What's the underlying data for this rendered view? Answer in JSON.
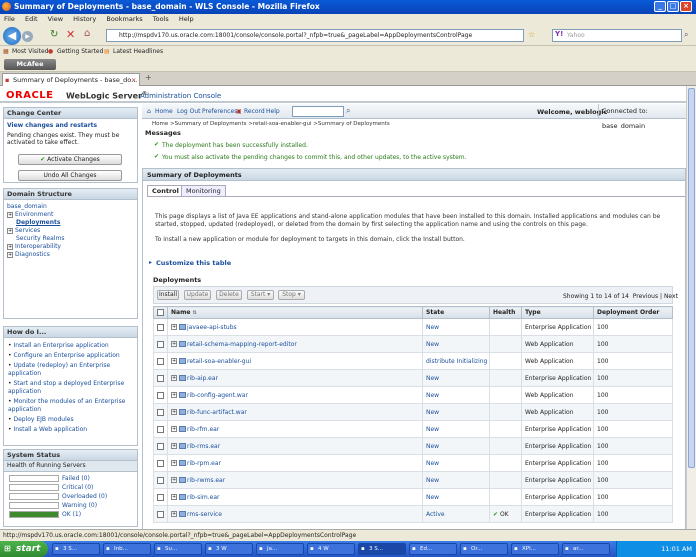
{
  "window": {
    "title": "Summary of Deployments - base_domain - WLS Console - Mozilla Firefox"
  },
  "menu": [
    "File",
    "Edit",
    "View",
    "History",
    "Bookmarks",
    "Tools",
    "Help"
  ],
  "nav": {
    "url": "http://mspdv170.us.oracle.com:18001/console/console.portal?_nfpb=true&_pageLabel=AppDeploymentsControlPage",
    "search_placeholder": "Yahoo"
  },
  "bookmarks": [
    "Most Visited",
    "Getting Started",
    "Latest Headlines"
  ],
  "mcafee": "McAfee",
  "tab": {
    "label": "Summary of Deployments - base_do...",
    "new": "+"
  },
  "brand": {
    "oracle": "ORACLE",
    "product": "WebLogic Server",
    "reg": "®",
    "subtitle": "Administration Console"
  },
  "change_center": {
    "title": "Change Center",
    "link": "View changes and restarts",
    "text": "Pending changes exist. They must be activated to take effect.",
    "activate": "Activate Changes",
    "undo": "Undo All Changes"
  },
  "domain_structure": {
    "title": "Domain Structure",
    "items": [
      "base_domain",
      "Environment",
      "Deployments",
      "Services",
      "Security Realms",
      "Interoperability",
      "Diagnostics"
    ]
  },
  "howdo": {
    "title": "How do I...",
    "items": [
      "Install an Enterprise application",
      "Configure an Enterprise application",
      "Update (redeploy) an Enterprise application",
      "Start and stop a deployed Enterprise application",
      "Monitor the modules of an Enterprise application",
      "Deploy EJB modules",
      "Install a Web application"
    ]
  },
  "system_status": {
    "title": "System Status",
    "subtitle": "Health of Running Servers",
    "rows": [
      {
        "label": "Failed (0)",
        "color": "#ffffff",
        "fill": 0
      },
      {
        "label": "Critical (0)",
        "color": "#ffffff",
        "fill": 0
      },
      {
        "label": "Overloaded (0)",
        "color": "#ffffff",
        "fill": 0
      },
      {
        "label": "Warning (0)",
        "color": "#ffffff",
        "fill": 0
      },
      {
        "label": "OK (1)",
        "color": "#3f8a2e",
        "fill": 1
      }
    ]
  },
  "topnav": {
    "home": "Home",
    "logout": "Log Out",
    "preferences": "Preferences",
    "record": "Record",
    "help": "Help",
    "welcome": "Welcome, weblogic",
    "connected": "Connected to: base_domain"
  },
  "breadcrumb": "Home >Summary of Deployments >retail-soa-enabler-gui >Summary of Deployments",
  "messages": {
    "title": "Messages",
    "items": [
      "The deployment has been successfully installed.",
      "You must also activate the pending changes to commit this, and other updates, to the active system."
    ]
  },
  "summary": {
    "title": "Summary of Deployments",
    "tabs": [
      "Control",
      "Monitoring"
    ],
    "desc1": "This page displays a list of Java EE applications and stand-alone application modules that have been installed to this domain. Installed applications and modules can be started, stopped, updated (redeployed), or deleted from the domain by first selecting the application name and using the controls on this page.",
    "desc2": "To install a new application or module for deployment to targets in this domain, click the Install button.",
    "customize": "Customize this table",
    "section": "Deployments",
    "buttons": {
      "install": "Install",
      "update": "Update",
      "delete": "Delete",
      "start": "Start",
      "stop": "Stop"
    },
    "paging": "Showing 1 to 14 of 14",
    "previous": "Previous",
    "next": "Next"
  },
  "table": {
    "headers": [
      "Name",
      "State",
      "Health",
      "Type",
      "Deployment Order"
    ],
    "rows": [
      {
        "name": "javaee-api-stubs",
        "state": "New",
        "health": "",
        "type": "Enterprise Application",
        "order": "100"
      },
      {
        "name": "retail-schema-mapping-report-editor",
        "state": "New",
        "health": "",
        "type": "Web Application",
        "order": "100"
      },
      {
        "name": "retail-soa-enabler-gui",
        "state": "distribute Initializing",
        "health": "",
        "type": "Web Application",
        "order": "100"
      },
      {
        "name": "rib-aip.ear",
        "state": "New",
        "health": "",
        "type": "Enterprise Application",
        "order": "100"
      },
      {
        "name": "rib-config-agent.war",
        "state": "New",
        "health": "",
        "type": "Web Application",
        "order": "100"
      },
      {
        "name": "rib-func-artifact.war",
        "state": "New",
        "health": "",
        "type": "Web Application",
        "order": "100"
      },
      {
        "name": "rib-rfm.ear",
        "state": "New",
        "health": "",
        "type": "Enterprise Application",
        "order": "100"
      },
      {
        "name": "rib-rms.ear",
        "state": "New",
        "health": "",
        "type": "Enterprise Application",
        "order": "100"
      },
      {
        "name": "rib-rpm.ear",
        "state": "New",
        "health": "",
        "type": "Enterprise Application",
        "order": "100"
      },
      {
        "name": "rib-rwms.ear",
        "state": "New",
        "health": "",
        "type": "Enterprise Application",
        "order": "100"
      },
      {
        "name": "rib-sim.ear",
        "state": "New",
        "health": "",
        "type": "Enterprise Application",
        "order": "100"
      },
      {
        "name": "rms-service",
        "state": "Active",
        "health": "OK",
        "type": "Enterprise Application",
        "order": "100"
      }
    ]
  },
  "statusbar": "http://mspdv170.us.oracle.com:18001/console/console.portal?_nfpb=true&_pageLabel=AppDeploymentsControlPage",
  "taskbar": {
    "start": "start",
    "items": [
      "3 S...",
      "Inb...",
      "Su...",
      "3 W",
      "Ja...",
      "4 W",
      "3 S...",
      "Ed...",
      "Or...",
      "XPl...",
      "ar..."
    ],
    "clock": "11:01 AM"
  }
}
